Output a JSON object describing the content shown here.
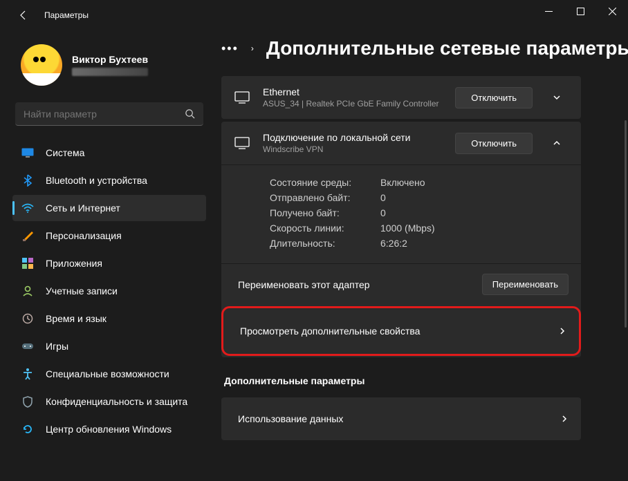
{
  "window": {
    "title": "Параметры"
  },
  "profile": {
    "name": "Виктор Бухтеев"
  },
  "search": {
    "placeholder": "Найти параметр"
  },
  "nav": {
    "items": [
      {
        "label": "Система"
      },
      {
        "label": "Bluetooth и устройства"
      },
      {
        "label": "Сеть и Интернет"
      },
      {
        "label": "Персонализация"
      },
      {
        "label": "Приложения"
      },
      {
        "label": "Учетные записи"
      },
      {
        "label": "Время и язык"
      },
      {
        "label": "Игры"
      },
      {
        "label": "Специальные возможности"
      },
      {
        "label": "Конфиденциальность и защита"
      },
      {
        "label": "Центр обновления Windows"
      }
    ]
  },
  "page": {
    "breadcrumb_sep": "›",
    "title": "Дополнительные сетевые параметры"
  },
  "adapters": {
    "ethernet": {
      "title": "Ethernet",
      "subtitle": "ASUS_34 | Realtek PCIe GbE Family Controller",
      "action": "Отключить"
    },
    "local": {
      "title": "Подключение по локальной сети",
      "subtitle": "Windscribe VPN",
      "action": "Отключить",
      "stats": {
        "media_label": "Состояние среды:",
        "media_value": "Включено",
        "sent_label": "Отправлено байт:",
        "sent_value": "0",
        "recv_label": "Получено байт:",
        "recv_value": "0",
        "speed_label": "Скорость линии:",
        "speed_value": "1000 (Mbps)",
        "dur_label": "Длительность:",
        "dur_value": "6:26:2"
      },
      "rename_label": "Переименовать этот адаптер",
      "rename_btn": "Переименовать",
      "props_label": "Просмотреть дополнительные свойства"
    }
  },
  "extra": {
    "section": "Дополнительные параметры",
    "data_usage": "Использование данных"
  }
}
